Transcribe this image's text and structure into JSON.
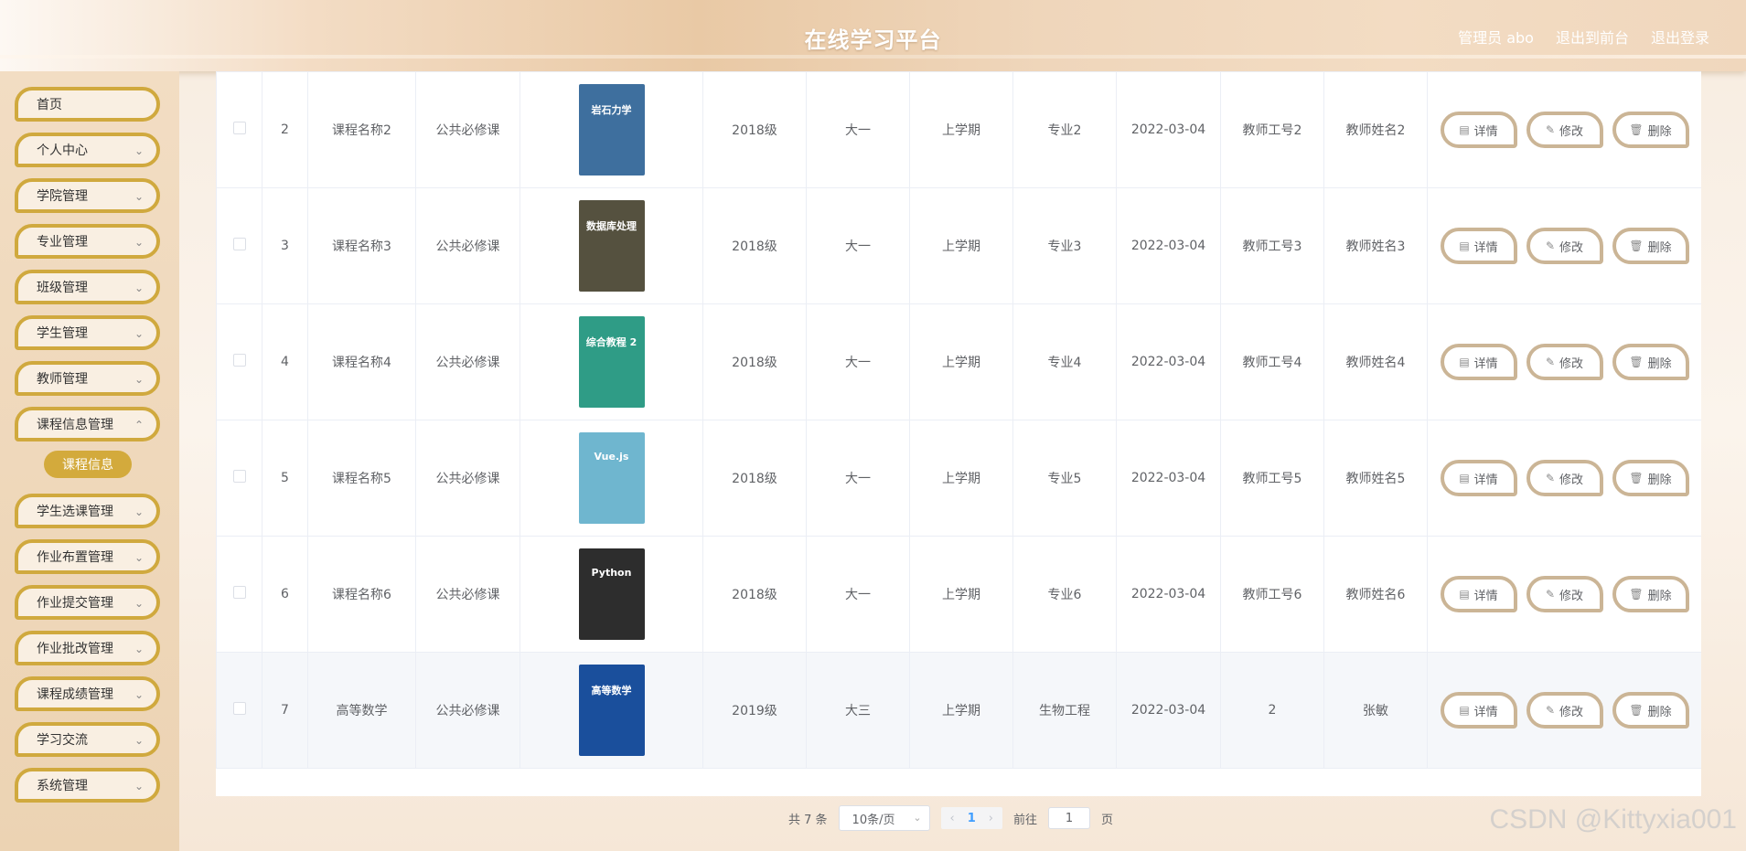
{
  "header": {
    "title": "在线学习平台",
    "admin": "管理员 abo",
    "to_front": "退出到前台",
    "logout": "退出登录"
  },
  "sidebar": {
    "items": [
      {
        "label": "首页"
      },
      {
        "label": "个人中心"
      },
      {
        "label": "学院管理"
      },
      {
        "label": "专业管理"
      },
      {
        "label": "班级管理"
      },
      {
        "label": "学生管理"
      },
      {
        "label": "教师管理"
      },
      {
        "label": "课程信息管理"
      },
      {
        "label": "学生选课管理"
      },
      {
        "label": "作业布置管理"
      },
      {
        "label": "作业提交管理"
      },
      {
        "label": "作业批改管理"
      },
      {
        "label": "课程成绩管理"
      },
      {
        "label": "学习交流"
      },
      {
        "label": "系统管理"
      }
    ],
    "active_sub": "课程信息"
  },
  "table": {
    "rows": [
      {
        "no": "2",
        "name": "课程名称2",
        "type": "公共必修课",
        "cover": "岩石力学",
        "cover_color": "#3e6f9e",
        "grade": "2018级",
        "year": "大一",
        "term": "上学期",
        "major": "专业2",
        "date": "2022-03-04",
        "tid": "教师工号2",
        "tname": "教师姓名2"
      },
      {
        "no": "3",
        "name": "课程名称3",
        "type": "公共必修课",
        "cover": "数据库处理",
        "cover_color": "#55513f",
        "grade": "2018级",
        "year": "大一",
        "term": "上学期",
        "major": "专业3",
        "date": "2022-03-04",
        "tid": "教师工号3",
        "tname": "教师姓名3"
      },
      {
        "no": "4",
        "name": "课程名称4",
        "type": "公共必修课",
        "cover": "综合教程 2",
        "cover_color": "#2f9c86",
        "grade": "2018级",
        "year": "大一",
        "term": "上学期",
        "major": "专业4",
        "date": "2022-03-04",
        "tid": "教师工号4",
        "tname": "教师姓名4"
      },
      {
        "no": "5",
        "name": "课程名称5",
        "type": "公共必修课",
        "cover": "Vue.js",
        "cover_color": "#6fb6cf",
        "grade": "2018级",
        "year": "大一",
        "term": "上学期",
        "major": "专业5",
        "date": "2022-03-04",
        "tid": "教师工号5",
        "tname": "教师姓名5"
      },
      {
        "no": "6",
        "name": "课程名称6",
        "type": "公共必修课",
        "cover": "Python",
        "cover_color": "#2d2d2d",
        "grade": "2018级",
        "year": "大一",
        "term": "上学期",
        "major": "专业6",
        "date": "2022-03-04",
        "tid": "教师工号6",
        "tname": "教师姓名6"
      },
      {
        "no": "7",
        "name": "高等数学",
        "type": "公共必修课",
        "cover": "高等数学",
        "cover_color": "#1a4f9c",
        "grade": "2019级",
        "year": "大三",
        "term": "上学期",
        "major": "生物工程",
        "date": "2022-03-04",
        "tid": "2",
        "tname": "张敏"
      }
    ],
    "actions": {
      "detail": "详情",
      "edit": "修改",
      "delete": "删除"
    }
  },
  "pager": {
    "total": "共 7 条",
    "page_size": "10条/页",
    "current": "1",
    "goto_prefix": "前往",
    "goto_value": "1",
    "goto_suffix": "页"
  },
  "watermark": "CSDN @Kittyxia001"
}
